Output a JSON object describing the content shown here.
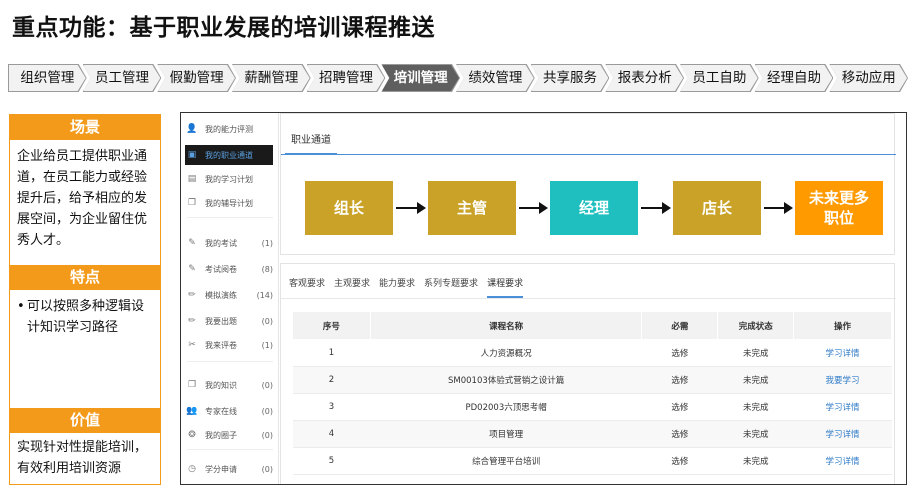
{
  "page_title": "重点功能：基于职业发展的培训课程推送",
  "modules": [
    {
      "label": "组织管理",
      "active": false
    },
    {
      "label": "员工管理",
      "active": false
    },
    {
      "label": "假勤管理",
      "active": false
    },
    {
      "label": "薪酬管理",
      "active": false
    },
    {
      "label": "招聘管理",
      "active": false
    },
    {
      "label": "培训管理",
      "active": true
    },
    {
      "label": "绩效管理",
      "active": false
    },
    {
      "label": "共享服务",
      "active": false
    },
    {
      "label": "报表分析",
      "active": false
    },
    {
      "label": "员工自助",
      "active": false
    },
    {
      "label": "经理自助",
      "active": false
    },
    {
      "label": "移动应用",
      "active": false
    }
  ],
  "info": {
    "scene_title": "场景",
    "scene_text": "企业给员工提供职业通道，在员工能力或经验提升后，给予相应的发展空间，为企业留住优秀人才。",
    "feature_title": "特点",
    "feature_items": [
      "可以按照多种逻辑设计知识学习路径"
    ],
    "value_title": "价值",
    "value_text": "实现针对性提能培训，有效利用培训资源"
  },
  "side_nav": [
    {
      "label": "我的能力评测",
      "count": "",
      "icon": "person-icon",
      "glyph": "👤",
      "active": false
    },
    {
      "label": "我的职业通道",
      "count": "",
      "icon": "save-icon",
      "glyph": "▣",
      "active": true
    },
    {
      "label": "我的学习计划",
      "count": "",
      "icon": "plan-icon",
      "glyph": "▤",
      "active": false
    },
    {
      "label": "我的辅导计划",
      "count": "",
      "icon": "copy-icon",
      "glyph": "❐",
      "active": false
    },
    {
      "label": "我的考试",
      "count": "(1)",
      "icon": "edit-icon",
      "glyph": "✎",
      "active": false
    },
    {
      "label": "考试阅卷",
      "count": "(8)",
      "icon": "edit-icon",
      "glyph": "✎",
      "active": false
    },
    {
      "label": "模拟演练",
      "count": "(14)",
      "icon": "pencil-icon",
      "glyph": "✏",
      "active": false
    },
    {
      "label": "我要出题",
      "count": "(0)",
      "icon": "pencil-icon",
      "glyph": "✏",
      "active": false
    },
    {
      "label": "我来评卷",
      "count": "(1)",
      "icon": "scissors-icon",
      "glyph": "✂",
      "active": false
    },
    {
      "label": "我的知识",
      "count": "(0)",
      "icon": "document-icon",
      "glyph": "❒",
      "active": false
    },
    {
      "label": "专家在线",
      "count": "(0)",
      "icon": "group-icon",
      "glyph": "👥",
      "active": false
    },
    {
      "label": "我的圈子",
      "count": "(0)",
      "icon": "circle-icon",
      "glyph": "❂",
      "active": false
    },
    {
      "label": "学分申请",
      "count": "(0)",
      "icon": "clock-icon",
      "glyph": "◷",
      "active": false
    }
  ],
  "career": {
    "tab_label": "职业通道",
    "steps": [
      {
        "label": "组长",
        "color": "#c9a227"
      },
      {
        "label": "主管",
        "color": "#c9a227"
      },
      {
        "label": "经理",
        "color": "#1fbfbf"
      },
      {
        "label": "店长",
        "color": "#c9a227"
      },
      {
        "label": "未来更多\n职位",
        "color": "#ff9a00"
      }
    ]
  },
  "requirements": {
    "tabs": [
      "客观要求",
      "主观要求",
      "能力要求",
      "系列专题要求",
      "课程要求"
    ],
    "active_index": 4,
    "columns": [
      "序号",
      "课程名称",
      "必需",
      "完成状态",
      "操作"
    ],
    "rows": [
      {
        "idx": "1",
        "name": "人力资源概况",
        "required": "选修",
        "state": "未完成",
        "action": "学习详情"
      },
      {
        "idx": "2",
        "name": "SM00103体验式营销之设计篇",
        "required": "选修",
        "state": "未完成",
        "action": "我要学习"
      },
      {
        "idx": "3",
        "name": "PD02003六顶思考帽",
        "required": "选修",
        "state": "未完成",
        "action": "学习详情"
      },
      {
        "idx": "4",
        "name": "项目管理",
        "required": "选修",
        "state": "未完成",
        "action": "学习详情"
      },
      {
        "idx": "5",
        "name": "综合管理平台培训",
        "required": "选修",
        "state": "未完成",
        "action": "学习详情"
      }
    ]
  }
}
